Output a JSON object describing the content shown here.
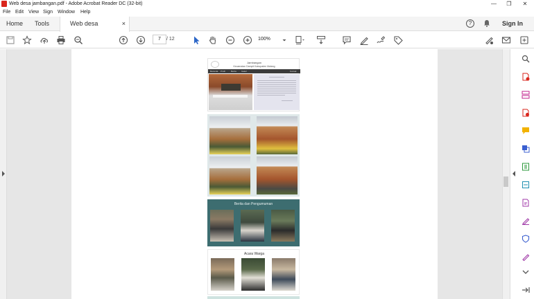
{
  "window": {
    "title": "Web desa jambangan.pdf - Adobe Acrobat Reader DC (32-bit)",
    "controls": [
      "—",
      "❐",
      "✕"
    ]
  },
  "menu": [
    "File",
    "Edit",
    "View",
    "Sign",
    "Window",
    "Help"
  ],
  "tabs": {
    "home": "Home",
    "tools": "Tools",
    "document": "Web desa jambangan...",
    "close": "×",
    "sign_in": "Sign In",
    "help": "?"
  },
  "toolbar": {
    "current_page": "7",
    "page_count": "/ 12",
    "zoom": "100%"
  },
  "document": {
    "header_line1": "Jambangan",
    "header_line2": "Kecamatan Dampit Kabupaten Malang",
    "nav": [
      "Beranda",
      "Profil",
      "Berita",
      "Galeri",
      "Kontak"
    ],
    "section_news": "Berita dan Pengumuman",
    "section_events": "Acara Warga"
  },
  "colors": {
    "teal": "#3d6d70",
    "accent_red": "#d9251c",
    "cursor_blue": "#2c66c7"
  }
}
